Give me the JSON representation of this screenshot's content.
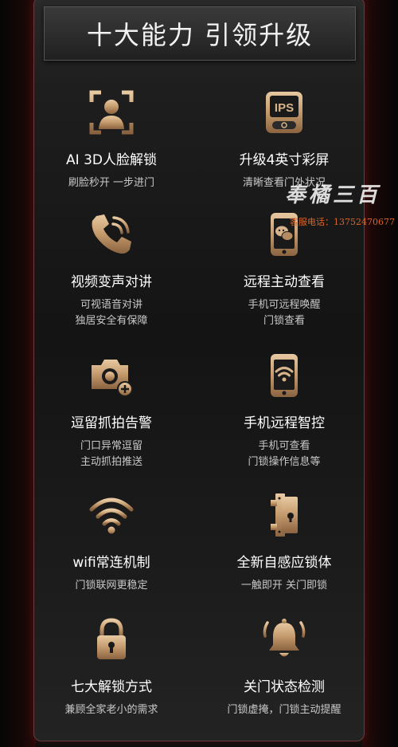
{
  "header": {
    "title": "十大能力 引领升级"
  },
  "features": [
    {
      "title": "AI 3D人脸解锁",
      "desc1": "刷脸秒开 一步进门",
      "desc2": ""
    },
    {
      "title": "升级4英寸彩屏",
      "desc1": "清晰查看门外状况",
      "desc2": ""
    },
    {
      "title": "视频变声对讲",
      "desc1": "可视语音对讲",
      "desc2": "独居安全有保障"
    },
    {
      "title": "远程主动查看",
      "desc1": "手机可远程唤醒",
      "desc2": "门锁查看"
    },
    {
      "title": "逗留抓拍告警",
      "desc1": "门口异常逗留",
      "desc2": "主动抓拍推送"
    },
    {
      "title": "手机远程智控",
      "desc1": "手机可查看",
      "desc2": "门锁操作信息等"
    },
    {
      "title": "wifi常连机制",
      "desc1": "门锁联网更稳定",
      "desc2": ""
    },
    {
      "title": "全新自感应锁体",
      "desc1": "一触即开 关门即锁",
      "desc2": ""
    },
    {
      "title": "七大解锁方式",
      "desc1": "兼顾全家老小的需求",
      "desc2": ""
    },
    {
      "title": "关门状态检测",
      "desc1": "门锁虚掩，门锁主动提醒",
      "desc2": ""
    }
  ],
  "icons": [
    "face-scan-icon",
    "ips-screen-icon",
    "phone-call-icon",
    "phone-wechat-icon",
    "camera-plus-icon",
    "phone-wifi-icon",
    "wifi-icon",
    "lock-body-icon",
    "padlock-icon",
    "bell-alarm-icon"
  ],
  "watermark": {
    "brand": "奉橘三百",
    "phone": "客服电话：13752470677"
  },
  "colors": {
    "gold": "#c9a27a",
    "gold_dark": "#7a5634",
    "background": "#141414",
    "title_text": "#f2f2f2"
  }
}
